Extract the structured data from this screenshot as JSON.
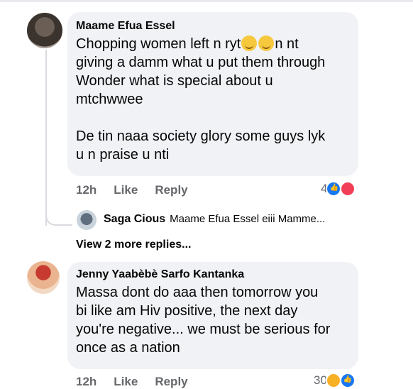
{
  "comments": [
    {
      "author": "Maame Efua Essel",
      "text": "Chopping women left n ryt",
      "text_tail": "n nt\ngiving a damm what u put them through\nWonder what is special about u\nmtchwwee\n\nDe tin naaa society glory some guys lyk\nu n praise u nti",
      "time": "12h",
      "like_label": "Like",
      "reply_label": "Reply",
      "reaction_count": "4",
      "reactions": [
        "like",
        "love"
      ]
    },
    {
      "author": "Jenny Yaabèbè Sarfo Kantanka",
      "text": "Massa dont do aaa then tomorrow you\nbi like am Hiv positive, the next day\nyou're negative... we must be serious for\nonce as a nation",
      "time": "12h",
      "like_label": "Like",
      "reply_label": "Reply",
      "reaction_count": "30",
      "reactions": [
        "haha",
        "like"
      ]
    }
  ],
  "reply_preview": {
    "author": "Saga Cious",
    "text": "Maame Efua Essel eiii Mamme..."
  },
  "more_replies": "View 2 more replies...",
  "colors": {
    "bubble": "#f0f2f5",
    "secondary_text": "#65676b",
    "like": "#1877f2",
    "love": "#f33e58",
    "haha": "#f7b125"
  }
}
